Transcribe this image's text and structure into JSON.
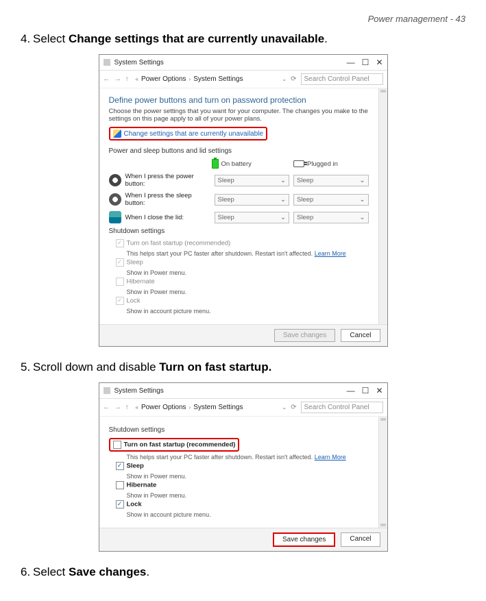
{
  "page_header": "Power management - 43",
  "steps": {
    "s4_num": "4.",
    "s4_pre": "Select ",
    "s4_bold": "Change settings that are currently unavailable",
    "s4_post": ".",
    "s5_num": "5.",
    "s5_pre": "Scroll down and disable ",
    "s5_bold": "Turn on fast startup.",
    "s6_num": "6.",
    "s6_pre": "Select ",
    "s6_bold": "Save changes",
    "s6_post": "."
  },
  "win": {
    "title": "System Settings",
    "bc1": "Power Options",
    "bc2": "System Settings",
    "search_ph": "Search Control Panel",
    "minimize": "—",
    "maximize": "☐",
    "close": "✕",
    "refresh": "⟳",
    "chev": "«"
  },
  "panel1": {
    "sec_title": "Define power buttons and turn on password protection",
    "sec_desc": "Choose the power settings that you want for your computer. The changes you make to the settings on this page apply to all of your power plans.",
    "change_link": "Change settings that are currently unavailable",
    "subhead1": "Power and sleep buttons and lid settings",
    "on_battery": "On battery",
    "plugged_in": "Plugged in",
    "row_power": "When I press the power button:",
    "row_sleep": "When I press the sleep button:",
    "row_lid": "When I close the lid:",
    "sel_value": "Sleep",
    "chev_down": "⌄",
    "shutdown_head": "Shutdown settings",
    "opt1": "Turn on fast startup (recommended)",
    "opt1_desc_a": "This helps start your PC faster after shutdown. Restart isn't affected. ",
    "opt1_learn": "Learn More",
    "opt2": "Sleep",
    "opt2_desc": "Show in Power menu.",
    "opt3": "Hibernate",
    "opt3_desc": "Show in Power menu.",
    "opt4": "Lock",
    "opt4_desc": "Show in account picture menu.",
    "save": "Save changes",
    "cancel": "Cancel"
  }
}
